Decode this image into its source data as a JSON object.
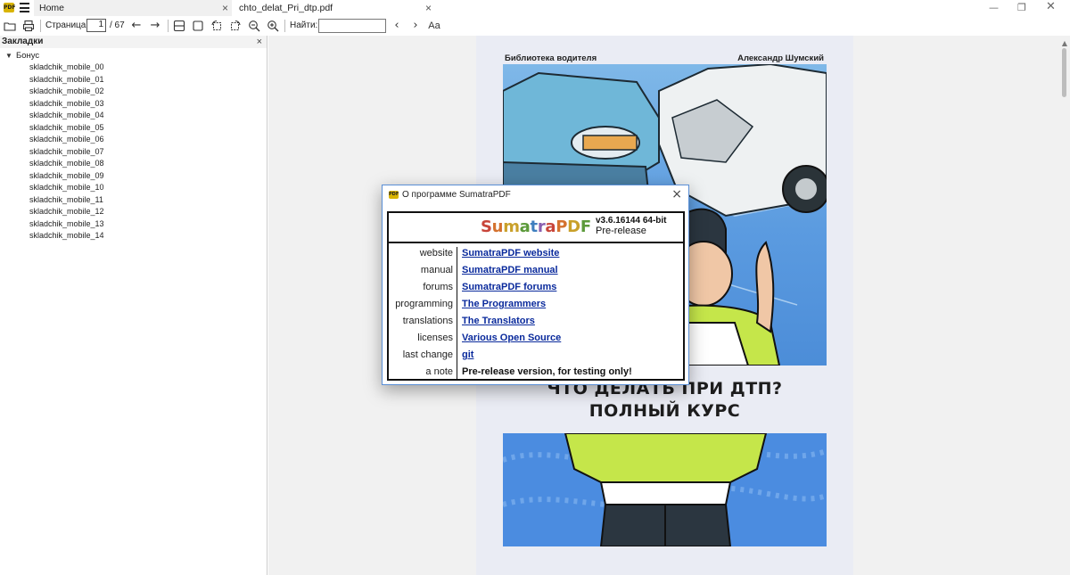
{
  "tabs": [
    {
      "label": "Home"
    },
    {
      "label": "chto_delat_Pri_dtp.pdf"
    }
  ],
  "toolbar": {
    "page_label": "Страница:",
    "page_current": "1",
    "page_total": "/ 67",
    "find_label": "Найти:"
  },
  "sidebar": {
    "title": "Закладки",
    "root": "Бонус",
    "items": [
      "skladchik_mobile_00",
      "skladchik_mobile_01",
      "skladchik_mobile_02",
      "skladchik_mobile_03",
      "skladchik_mobile_04",
      "skladchik_mobile_05",
      "skladchik_mobile_06",
      "skladchik_mobile_07",
      "skladchik_mobile_08",
      "skladchik_mobile_09",
      "skladchik_mobile_10",
      "skladchik_mobile_11",
      "skladchik_mobile_12",
      "skladchik_mobile_13",
      "skladchik_mobile_14"
    ]
  },
  "page": {
    "series": "Библиотека водителя",
    "author": "Александр Шумский",
    "title_line1": "ЧТО ДЕЛАТЬ ПРИ ДТП?",
    "title_line2": "ПОЛНЫЙ КУРС"
  },
  "dialog": {
    "title": "О программе SumatraPDF",
    "brand_letters": [
      {
        "ch": "S",
        "color": "#c8453a"
      },
      {
        "ch": "u",
        "color": "#d4722f"
      },
      {
        "ch": "m",
        "color": "#c9a02a"
      },
      {
        "ch": "a",
        "color": "#5c9a3a"
      },
      {
        "ch": "t",
        "color": "#3f7fbf"
      },
      {
        "ch": "r",
        "color": "#8a5fb0"
      },
      {
        "ch": "a",
        "color": "#c8453a"
      },
      {
        "ch": "P",
        "color": "#d4722f"
      },
      {
        "ch": "D",
        "color": "#c9a02a"
      },
      {
        "ch": "F",
        "color": "#5c9a3a"
      }
    ],
    "version": "v3.6.16144 64-bit",
    "prerelease": "Pre-release",
    "rows": [
      {
        "key": "website",
        "value": "SumatraPDF website",
        "link": true
      },
      {
        "key": "manual",
        "value": "SumatraPDF manual",
        "link": true
      },
      {
        "key": "forums",
        "value": "SumatraPDF forums",
        "link": true
      },
      {
        "key": "programming",
        "value": "The Programmers",
        "link": true
      },
      {
        "key": "translations",
        "value": "The Translators",
        "link": true
      },
      {
        "key": "licenses",
        "value": "Various Open Source",
        "link": true
      },
      {
        "key": "last change",
        "value": "git ",
        "link": true
      },
      {
        "key": "a note",
        "value": "Pre-release version, for testing only!",
        "link": false
      }
    ]
  },
  "colors": {
    "accent_link": "#0a2a9c",
    "dialog_border": "#5a8fd6",
    "logo_yellow": "#d9b400"
  }
}
